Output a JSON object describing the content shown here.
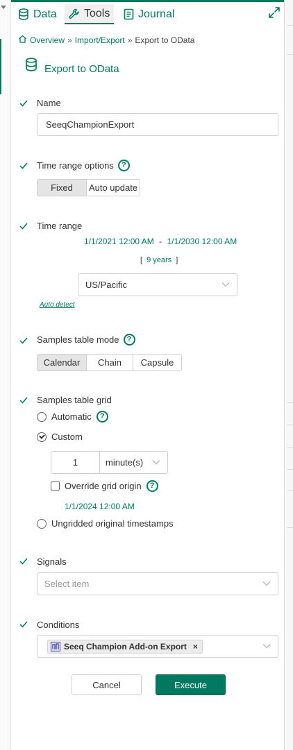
{
  "tabs": [
    {
      "label": "Data",
      "icon": "database-icon",
      "active": false
    },
    {
      "label": "Tools",
      "icon": "wrench-icon",
      "active": true
    },
    {
      "label": "Journal",
      "icon": "journal-icon",
      "active": false
    }
  ],
  "breadcrumb": {
    "home": "Overview",
    "sep1": "»",
    "middle": "Import/Export",
    "sep2": "»",
    "current": "Export to OData"
  },
  "tool": {
    "title": "Export to OData",
    "icon": "database-icon"
  },
  "name": {
    "label": "Name",
    "value": "SeeqChampionExport"
  },
  "time_range_options": {
    "label": "Time range options",
    "options": [
      "Fixed",
      "Auto update"
    ],
    "selected": "Fixed"
  },
  "time_range": {
    "label": "Time range",
    "start": "1/1/2021 12:00 AM",
    "separator": "-",
    "end": "1/1/2030 12:00 AM",
    "duration_open": "[",
    "duration": "9 years",
    "duration_close": "]",
    "timezone": "US/Pacific",
    "auto_detect": "Auto detect"
  },
  "samples_table_mode": {
    "label": "Samples table mode",
    "options": [
      "Calendar",
      "Chain",
      "Capsule"
    ],
    "selected": "Calendar"
  },
  "samples_table_grid": {
    "label": "Samples table grid",
    "automatic": "Automatic",
    "custom": "Custom",
    "selected": "Custom",
    "interval_value": "1",
    "interval_unit": "minute(s)",
    "override_label": "Override grid origin",
    "override_checked": false,
    "origin_date": "1/1/2024 12:00 AM",
    "ungridded": "Ungridded original timestamps"
  },
  "signals": {
    "label": "Signals",
    "placeholder": "Select item"
  },
  "conditions": {
    "label": "Conditions",
    "chip": "Seeq Champion Add-on Export",
    "chip_remove": "×"
  },
  "buttons": {
    "cancel": "Cancel",
    "execute": "Execute"
  },
  "colors": {
    "accent": "#007960",
    "selected_segment": "#e5e5e5"
  }
}
